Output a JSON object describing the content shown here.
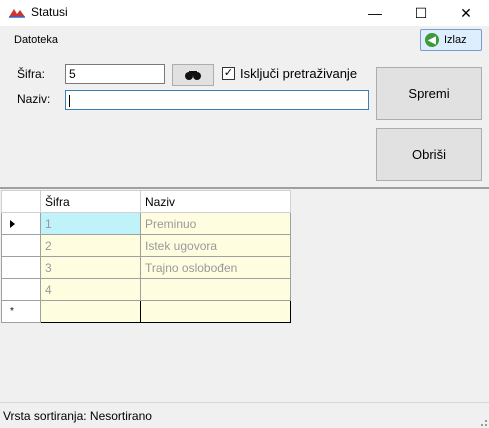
{
  "window": {
    "title": "Statusi",
    "minimize_glyph": "—",
    "maximize_glyph": "☐",
    "close_glyph": "✕"
  },
  "menu": {
    "file_label": "Datoteka",
    "exit_label": "Izlaz",
    "exit_icon": "back-arrow-icon"
  },
  "form": {
    "sifra_label": "Šifra:",
    "sifra_value": "5",
    "naziv_label": "Naziv:",
    "naziv_value": "",
    "search_icon": "binoculars-icon",
    "exclude_search_label": "Isključi pretraživanje",
    "exclude_search_checked": true,
    "save_label": "Spremi",
    "delete_label": "Obriši"
  },
  "grid": {
    "columns": [
      "Šifra",
      "Naziv"
    ],
    "rows": [
      {
        "sifra": "1",
        "naziv": "Preminuo"
      },
      {
        "sifra": "2",
        "naziv": "Istek ugovora"
      },
      {
        "sifra": "3",
        "naziv": "Trajno oslobođen"
      },
      {
        "sifra": "4",
        "naziv": ""
      }
    ],
    "new_row_marker": "*"
  },
  "status": {
    "sort_text": "Vrsta sortiranja: Nesortirano"
  },
  "colors": {
    "cell_background": "#fffde0",
    "selected_cell": "#bff2f9",
    "form_background": "#f0f0f0",
    "exit_icon_color": "#3c9a3c"
  }
}
